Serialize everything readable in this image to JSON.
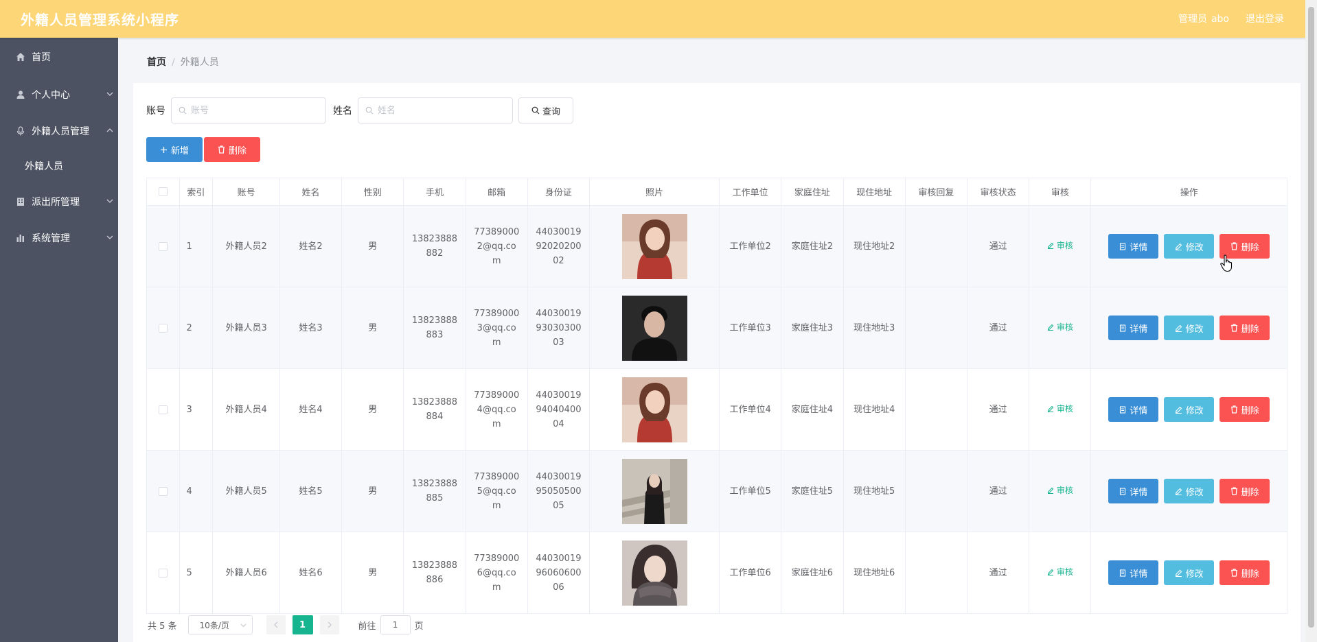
{
  "header": {
    "title": "外籍人员管理系统小程序",
    "admin_label": "管理员",
    "admin_name": "abo",
    "logout": "退出登录"
  },
  "sidebar": {
    "items": [
      {
        "label": "首页",
        "icon": "home-icon"
      },
      {
        "label": "个人中心",
        "icon": "user-icon"
      },
      {
        "label": "外籍人员管理",
        "icon": "microphone-icon",
        "expanded": true
      },
      {
        "label": "外籍人员",
        "sub": true
      },
      {
        "label": "派出所管理",
        "icon": "building-icon"
      },
      {
        "label": "系统管理",
        "icon": "chart-icon"
      }
    ]
  },
  "breadcrumb": {
    "home": "首页",
    "sep": "/",
    "current": "外籍人员"
  },
  "search": {
    "account_label": "账号",
    "account_placeholder": "账号",
    "name_label": "姓名",
    "name_placeholder": "姓名",
    "query_button": "查询"
  },
  "actions": {
    "add": "新增",
    "delete": "删除"
  },
  "table": {
    "columns": [
      "索引",
      "账号",
      "姓名",
      "性别",
      "手机",
      "邮箱",
      "身份证",
      "照片",
      "工作单位",
      "家庭住址",
      "现住地址",
      "审核回复",
      "审核状态",
      "审核",
      "操作"
    ],
    "rows": [
      {
        "idx": "1",
        "account": "外籍人员2",
        "name": "姓名2",
        "gender": "男",
        "phone": "13823888882",
        "email": "773890002@qq.com",
        "id_card": "440300199202020002",
        "photo": "photo-girl-red-sweater",
        "work": "工作单位2",
        "home": "家庭住址2",
        "current": "现住地址2",
        "reply": "",
        "status": "通过",
        "audit": "审核"
      },
      {
        "idx": "2",
        "account": "外籍人员3",
        "name": "姓名3",
        "gender": "男",
        "phone": "13823888883",
        "email": "773890003@qq.com",
        "id_card": "440300199303030003",
        "photo": "photo-boy-dark",
        "work": "工作单位3",
        "home": "家庭住址3",
        "current": "现住地址3",
        "reply": "",
        "status": "通过",
        "audit": "审核"
      },
      {
        "idx": "3",
        "account": "外籍人员4",
        "name": "姓名4",
        "gender": "男",
        "phone": "13823888884",
        "email": "773890004@qq.com",
        "id_card": "440300199404040004",
        "photo": "photo-girl-red-sweater",
        "work": "工作单位4",
        "home": "家庭住址4",
        "current": "现住地址4",
        "reply": "",
        "status": "通过",
        "audit": "审核"
      },
      {
        "idx": "4",
        "account": "外籍人员5",
        "name": "姓名5",
        "gender": "男",
        "phone": "13823888885",
        "email": "773890005@qq.com",
        "id_card": "440300199505050005",
        "photo": "photo-girl-stairs",
        "work": "工作单位5",
        "home": "家庭住址5",
        "current": "现住地址5",
        "reply": "",
        "status": "通过",
        "audit": "审核"
      },
      {
        "idx": "5",
        "account": "外籍人员6",
        "name": "姓名6",
        "gender": "男",
        "phone": "13823888886",
        "email": "773890006@qq.com",
        "id_card": "440300199606060006",
        "photo": "photo-girl-scarf",
        "work": "工作单位6",
        "home": "家庭住址6",
        "current": "现住地址6",
        "reply": "",
        "status": "通过",
        "audit": "审核"
      }
    ],
    "row_buttons": {
      "detail": "详情",
      "edit": "修改",
      "delete": "删除"
    }
  },
  "pagination": {
    "total": "共 5 条",
    "page_size": "10条/页",
    "current_page": "1",
    "goto_label": "前往",
    "goto_value": "1",
    "page_suffix": "页"
  },
  "colors": {
    "header_bg": "#fdd677",
    "sidebar_bg": "#4c5261",
    "primary": "#3a8ed6",
    "info": "#53bde0",
    "danger": "#fb5252",
    "accent": "#17b490"
  }
}
